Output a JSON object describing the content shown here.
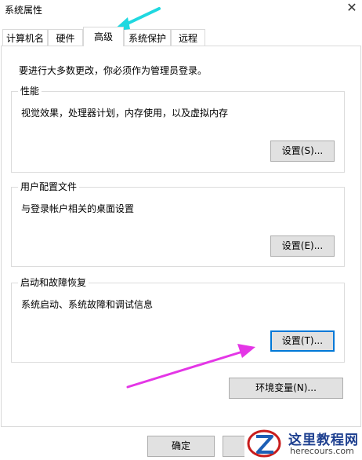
{
  "window": {
    "title": "系统属性",
    "close_icon": "close-icon"
  },
  "tabs": [
    {
      "label": "计算机名"
    },
    {
      "label": "硬件"
    },
    {
      "label": "高级"
    },
    {
      "label": "系统保护"
    },
    {
      "label": "远程"
    }
  ],
  "admin_note": "要进行大多数更改，你必须作为管理员登录。",
  "performance": {
    "title": "性能",
    "desc": "视觉效果，处理器计划，内存使用，以及虚拟内存",
    "button": "设置(S)..."
  },
  "user_profiles": {
    "title": "用户配置文件",
    "desc": "与登录帐户相关的桌面设置",
    "button": "设置(E)..."
  },
  "startup_recovery": {
    "title": "启动和故障恢复",
    "desc": "系统启动、系统故障和调试信息",
    "button": "设置(T)..."
  },
  "env_button": "环境变量(N)...",
  "ok_button": "确定",
  "watermark": {
    "name": "这里教程网",
    "url": "herecours.com"
  },
  "colors": {
    "arrow_cyan": "#1fd8e0",
    "arrow_magenta": "#e436e6",
    "focus_blue": "#0078d7"
  }
}
